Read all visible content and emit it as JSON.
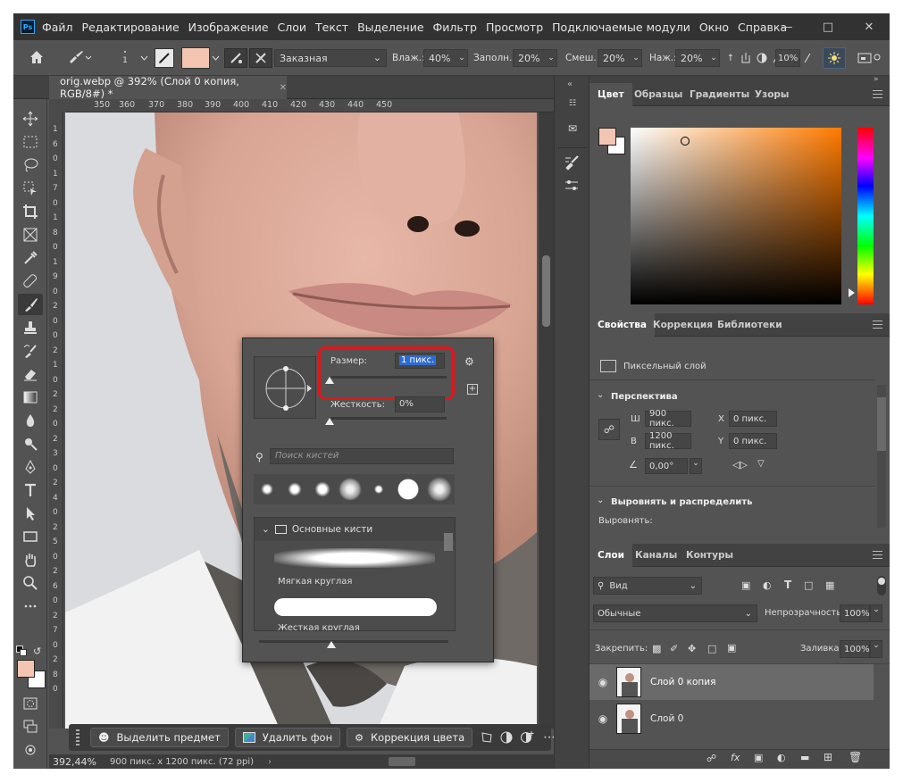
{
  "menu": {
    "items": [
      "Файл",
      "Редактирование",
      "Изображение",
      "Слои",
      "Текст",
      "Выделение",
      "Фильтр",
      "Просмотр",
      "Подключаемые модули",
      "Окно",
      "Справка"
    ],
    "ps_badge": "Ps"
  },
  "options": {
    "brush_size_small": "1",
    "mode": "Заказная",
    "wet_label": "Влаж.:",
    "wet_value": "40%",
    "load_label": "Заполн.:",
    "load_value": "20%",
    "mix_label": "Смеш.:",
    "mix_value": "20%",
    "flow_label": "Наж.:",
    "flow_value": "20%",
    "pressure_value": "10%",
    "fg_color": "#f4c6b2"
  },
  "document": {
    "tab_title": "orig.webp @ 392% (Слой 0 копия, RGB/8#) *",
    "ruler_h": [
      "350",
      "360",
      "370",
      "380",
      "390",
      "400",
      "410",
      "420",
      "430",
      "440",
      "450"
    ],
    "ruler_v": [
      "1",
      "6",
      "0",
      "1",
      "7",
      "0",
      "1",
      "8",
      "0",
      "1",
      "9",
      "0",
      "2",
      "0",
      "0",
      "2",
      "1",
      "0",
      "2",
      "2",
      "0",
      "2",
      "3",
      "0",
      "2",
      "4",
      "0",
      "2",
      "5",
      "0",
      "2",
      "6",
      "0",
      "2",
      "7",
      "0",
      "2",
      "8",
      "0"
    ],
    "zoom": "392,44%",
    "status": "900 пикс. x 1200 пикс. (72 ppi)"
  },
  "taskbar": {
    "select_subject": "Выделить предмет",
    "remove_bg": "Удалить фон",
    "color_correct": "Коррекция цвета"
  },
  "brush_popup": {
    "size_label": "Размер:",
    "size_value": "1 пикс.",
    "hardness_label": "Жесткость:",
    "hardness_value": "0%",
    "search_placeholder": "Поиск кистей",
    "group_name": "Основные кисти",
    "brush1": "Мягкая круглая",
    "brush2": "Жесткая круглая",
    "highlight_color": "#e0161a"
  },
  "color_panel": {
    "tabs": [
      "Цвет",
      "Образцы",
      "Градиенты",
      "Узоры"
    ],
    "fg": "#f4c6b2",
    "bg": "#ffffff",
    "hue": "#ff7a00"
  },
  "properties": {
    "tabs": [
      "Свойства",
      "Коррекция",
      "Библиотеки"
    ],
    "kind": "Пиксельный слой",
    "section_transform": "Перспектива",
    "w_label": "Ш",
    "w_value": "900 пикс.",
    "h_label": "В",
    "h_value": "1200 пикс.",
    "x_label": "X",
    "x_value": "0 пикс.",
    "y_label": "Y",
    "y_value": "0 пикс.",
    "angle_value": "0,00°",
    "section_align": "Выровнять и распределить",
    "align_label": "Выровнять:"
  },
  "layers": {
    "tabs": [
      "Слои",
      "Каналы",
      "Контуры"
    ],
    "filter": "Вид",
    "blend": "Обычные",
    "opacity_label": "Непрозрачность:",
    "opacity_value": "100%",
    "lock_label": "Закрепить:",
    "fill_label": "Заливка:",
    "fill_value": "100%",
    "items": [
      {
        "name": "Слой 0 копия",
        "selected": true
      },
      {
        "name": "Слой 0",
        "selected": false
      }
    ]
  }
}
